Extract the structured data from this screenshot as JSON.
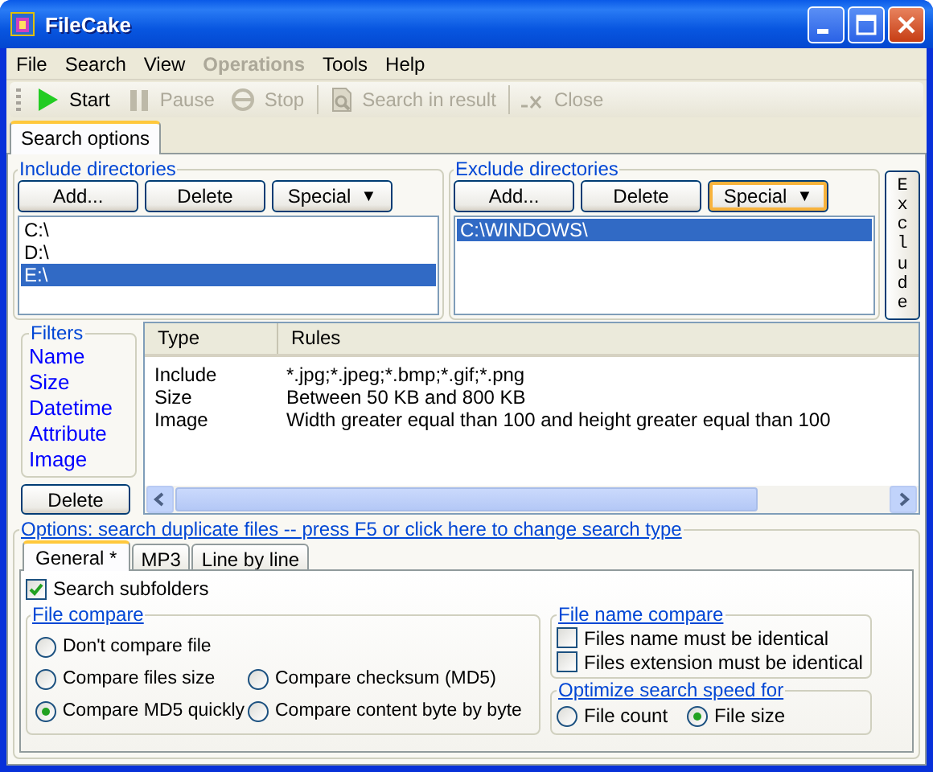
{
  "window": {
    "title": "FileCake"
  },
  "menu": [
    {
      "label": "File",
      "disabled": false
    },
    {
      "label": "Search",
      "disabled": false
    },
    {
      "label": "View",
      "disabled": false
    },
    {
      "label": "Operations",
      "disabled": true
    },
    {
      "label": "Tools",
      "disabled": false
    },
    {
      "label": "Help",
      "disabled": false
    }
  ],
  "toolbar": [
    {
      "kind": "play",
      "label": "Start",
      "disabled": false
    },
    {
      "kind": "pause",
      "label": "Pause",
      "disabled": true
    },
    {
      "kind": "stop",
      "label": "Stop",
      "disabled": true
    },
    {
      "kind": "separator"
    },
    {
      "kind": "search",
      "label": "Search in result",
      "disabled": true
    },
    {
      "kind": "separator"
    },
    {
      "kind": "close",
      "label": "Close",
      "disabled": true
    }
  ],
  "tabs": [
    {
      "label": "Search options",
      "selected": true
    }
  ],
  "include": {
    "title": "Include directories",
    "buttons": [
      {
        "label": "Add...",
        "hot": false
      },
      {
        "label": "Delete",
        "hot": false
      },
      {
        "label": "Special",
        "arrow": "▼",
        "hot": false
      }
    ],
    "items": [
      {
        "label": "C:\\",
        "selected": false
      },
      {
        "label": "D:\\",
        "selected": false
      },
      {
        "label": "E:\\",
        "selected": true
      }
    ]
  },
  "exclude": {
    "title": "Exclude directories",
    "buttons": [
      {
        "label": "Add...",
        "hot": false
      },
      {
        "label": "Delete",
        "hot": false
      },
      {
        "label": "Special",
        "arrow": "▼",
        "hot": true
      }
    ],
    "items": [
      {
        "label": "C:\\WINDOWS\\",
        "selected": true
      }
    ]
  },
  "exclude_button": "Exclude",
  "filters": {
    "title": "Filters",
    "items": [
      "Name",
      "Size",
      "Datetime",
      "Attribute",
      "Image"
    ],
    "delete_button": "Delete"
  },
  "filter_table": {
    "columns": [
      "Type",
      "Rules"
    ],
    "rows": [
      [
        "Include",
        "*.jpg;*.jpeg;*.bmp;*.gif;*.png"
      ],
      [
        "Size",
        "Between 50 KB and 800 KB"
      ],
      [
        "Image",
        "Width greater equal than 100 and height greater equal than 100"
      ]
    ]
  },
  "options": {
    "title": "Options: search duplicate files -- press F5 or click here to change search type",
    "tabs": [
      {
        "label": "General *",
        "selected": true
      },
      {
        "label": "MP3",
        "selected": false
      },
      {
        "label": "Line by line",
        "selected": false
      }
    ],
    "search_subfolders": {
      "label": "Search subfolders",
      "checked": true
    },
    "file_compare": {
      "title": "File compare",
      "rows": [
        [
          {
            "label": "Don't compare file",
            "selected": false
          }
        ],
        [
          {
            "label": "Compare files size",
            "selected": false
          },
          {
            "label": "Compare checksum (MD5)",
            "selected": false
          }
        ],
        [
          {
            "label": "Compare MD5 quickly",
            "selected": true
          },
          {
            "label": "Compare content byte by byte",
            "selected": false
          }
        ]
      ]
    },
    "file_name_compare": {
      "title": "File name compare",
      "items": [
        {
          "label": "Files name must be identical",
          "checked": false
        },
        {
          "label": "Files extension must be identical",
          "checked": false
        }
      ]
    },
    "optimize": {
      "title": "Optimize search speed for",
      "items": [
        {
          "label": "File count",
          "selected": false
        },
        {
          "label": "File size",
          "selected": true
        }
      ]
    }
  }
}
